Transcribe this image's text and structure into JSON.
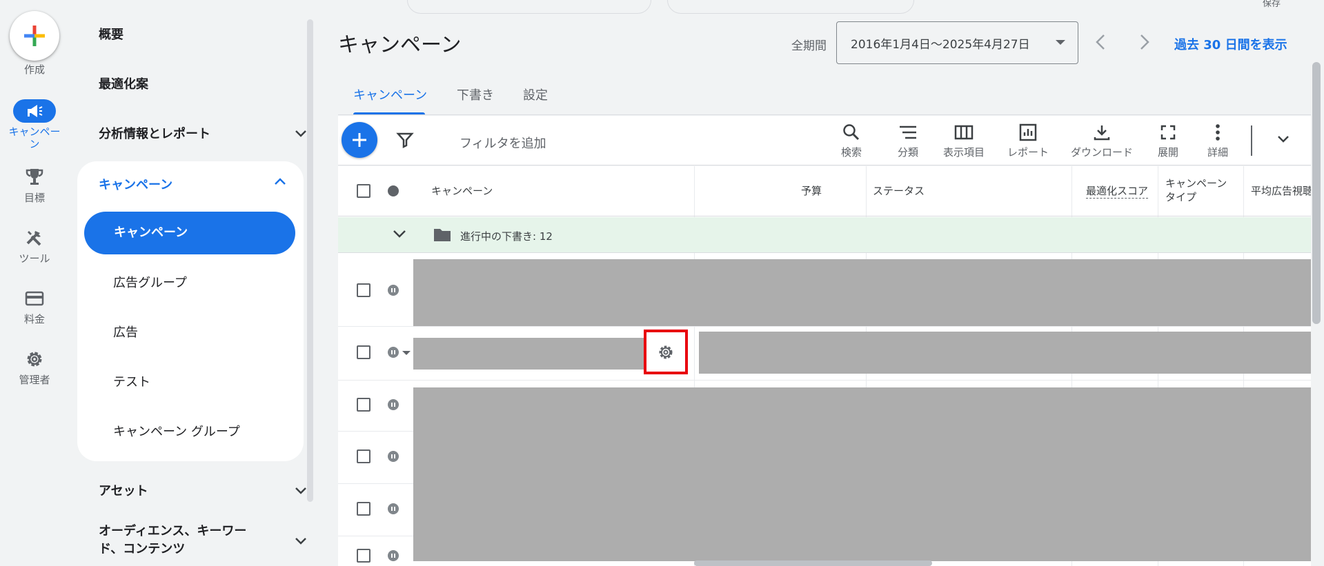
{
  "rail": {
    "create_label": "作成",
    "items": [
      {
        "label": "キャンペーン",
        "icon": "megaphone-icon",
        "active": true
      },
      {
        "label": "目標",
        "icon": "trophy-icon",
        "active": false
      },
      {
        "label": "ツール",
        "icon": "tools-icon",
        "active": false
      },
      {
        "label": "料金",
        "icon": "billing-card-icon",
        "active": false
      },
      {
        "label": "管理者",
        "icon": "gear-icon",
        "active": false
      }
    ]
  },
  "nav": {
    "overview": "概要",
    "recommendations": "最適化案",
    "insights": "分析情報とレポート",
    "campaigns_group": "キャンペーン",
    "active_item": "キャンペーン",
    "sub_items": [
      "広告グループ",
      "広告",
      "テスト",
      "キャンペーン グループ"
    ],
    "assets": "アセット",
    "audiences": "オーディエンス、キーワード、コンテンツ"
  },
  "header": {
    "title": "キャンペーン",
    "period_label": "全期間",
    "date_range": "2016年1月4日～2025年4月27日",
    "show_last_30": "過去 30 日間を表示",
    "save_stub": "保存"
  },
  "tabs": [
    "キャンペーン",
    "下書き",
    "設定"
  ],
  "toolbar": {
    "filter_placeholder": "フィルタを追加",
    "tools": [
      {
        "label": "検索",
        "icon": "search-icon"
      },
      {
        "label": "分類",
        "icon": "segment-icon"
      },
      {
        "label": "表示項目",
        "icon": "columns-icon"
      },
      {
        "label": "レポート",
        "icon": "report-icon"
      },
      {
        "label": "ダウンロード",
        "icon": "download-icon"
      },
      {
        "label": "展開",
        "icon": "expand-icon"
      },
      {
        "label": "詳細",
        "icon": "more-vert-icon"
      }
    ]
  },
  "table": {
    "columns": {
      "campaign": "キャンペーン",
      "budget": "予算",
      "status": "ステータス",
      "opt_score": "最適化スコア",
      "campaign_type_line1": "キャンペーン",
      "campaign_type_line2": "タイプ",
      "avg_view": "平均広告視聴"
    },
    "draft_row": "進行中の下書き: 12"
  },
  "colors": {
    "accent": "#1a73e8",
    "highlight": "#e8000d",
    "draft_bg": "#e6f4ea",
    "redacted": "#adadad"
  }
}
